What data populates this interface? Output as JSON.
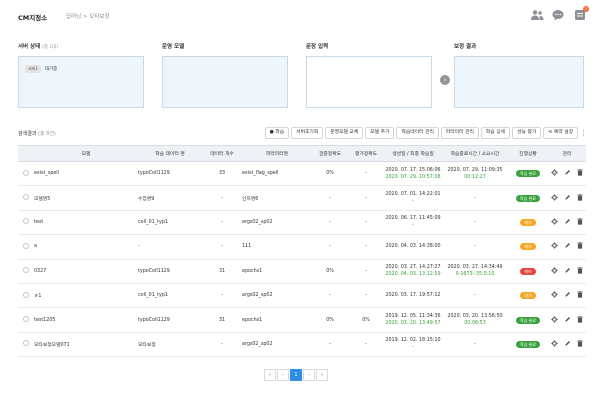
{
  "header": {
    "brand": "CM지정소",
    "breadcrumb": "딥러닝 > 오타보정",
    "notification_count": "2"
  },
  "panels": {
    "server_status": {
      "title": "서버 상태",
      "subtitle": "(총 1대)",
      "chip_tag": "서버1",
      "chip_label": "대기중"
    },
    "model": {
      "title": "운영 모델"
    },
    "input": {
      "title": "문장 입력"
    },
    "result": {
      "title": "보정 결과"
    }
  },
  "results": {
    "label": "검색결과",
    "count": "(총 8건)"
  },
  "toolbar": {
    "buttons": [
      "학습",
      "서버초기화",
      "운영모델 교체",
      "모델 추가",
      "학습데이터 관리",
      "파라미터 관리",
      "학습 상세",
      "성능 평가",
      "예약 설정"
    ]
  },
  "table": {
    "headers": [
      "모델",
      "학습 데이터 명",
      "데이터 개수",
      "파라미터명",
      "검증정확도",
      "평가정확도",
      "생성일 / 최종 학습일",
      "학습종료시간 / 소요시간",
      "진행상황",
      "관리"
    ],
    "rows": [
      {
        "model": "exist_spell",
        "data_name": "typoColl1129",
        "count": "33",
        "param": "exist_flag_spell",
        "val_acc": "0%",
        "eval_acc": "-",
        "created": "2020. 07. 17. 15:06:06",
        "trained": "2020. 07. 29. 10:57:08",
        "end_time": "2020. 07. 29. 11:09:35",
        "duration": "00:12:27",
        "status": "학습 완료"
      },
      {
        "model": "모델명5",
        "data_name": "수집명9",
        "count": "-",
        "param": "인자명6",
        "val_acc": "-",
        "eval_acc": "-",
        "created": "2020. 07. 01. 14:22:01",
        "trained": "-",
        "end_time": "-",
        "duration": "",
        "status": "학습 완료"
      },
      {
        "model": "test",
        "data_name": "coll_01_typ1",
        "count": "-",
        "param": "args02_sp02",
        "val_acc": "-",
        "eval_acc": "-",
        "created": "2020. 06. 17. 11:45:09",
        "trained": "-",
        "end_time": "-",
        "duration": "",
        "status": "대기"
      },
      {
        "model": "a",
        "data_name": "-",
        "count": "-",
        "param": "111",
        "val_acc": "-",
        "eval_acc": "-",
        "created": "2020. 04. 03. 14:38:00",
        "trained": "",
        "end_time": "-",
        "duration": "",
        "status": "대기"
      },
      {
        "model": "0327",
        "data_name": "typoColl1129",
        "count": "31",
        "param": "epochs1",
        "val_acc": "0%",
        "eval_acc": "-",
        "created": "2020. 03. 27. 14:27:27",
        "trained": "2020. 04. 03. 13:12:59",
        "end_time": "2020. 03. 27. 14:34:49",
        "duration": "0-1673:-35:0:10",
        "status": "에러"
      },
      {
        "model": "ㅎ1",
        "data_name": "coll_01_typ1",
        "count": "-",
        "param": "args02_sp02",
        "val_acc": "-",
        "eval_acc": "-",
        "created": "2020. 03. 17. 19:57:12",
        "trained": "",
        "end_time": "-",
        "duration": "",
        "status": "대기"
      },
      {
        "model": "test1205",
        "data_name": "typoColl1129",
        "count": "31",
        "param": "epochs1",
        "val_acc": "0%",
        "eval_acc": "0%",
        "created": "2019. 12. 05. 11:34:36",
        "trained": "2020. 03. 20. 13:49:57",
        "end_time": "2020. 03. 20. 13:56:50",
        "duration": "00:06:53",
        "status": "학습 완료"
      },
      {
        "model": "오타보정모델071",
        "data_name": "오타보정",
        "count": "-",
        "param": "args02_sp02",
        "val_acc": "-",
        "eval_acc": "-",
        "created": "2019. 12. 02. 18:15:10",
        "trained": "-",
        "end_time": "-",
        "duration": "",
        "status": "학습 완료"
      }
    ]
  },
  "status_colors": {
    "학습 완료": "#3aa23d",
    "대기": "#f5a623",
    "에러": "#e8453c"
  },
  "pager": {
    "current": "1"
  }
}
